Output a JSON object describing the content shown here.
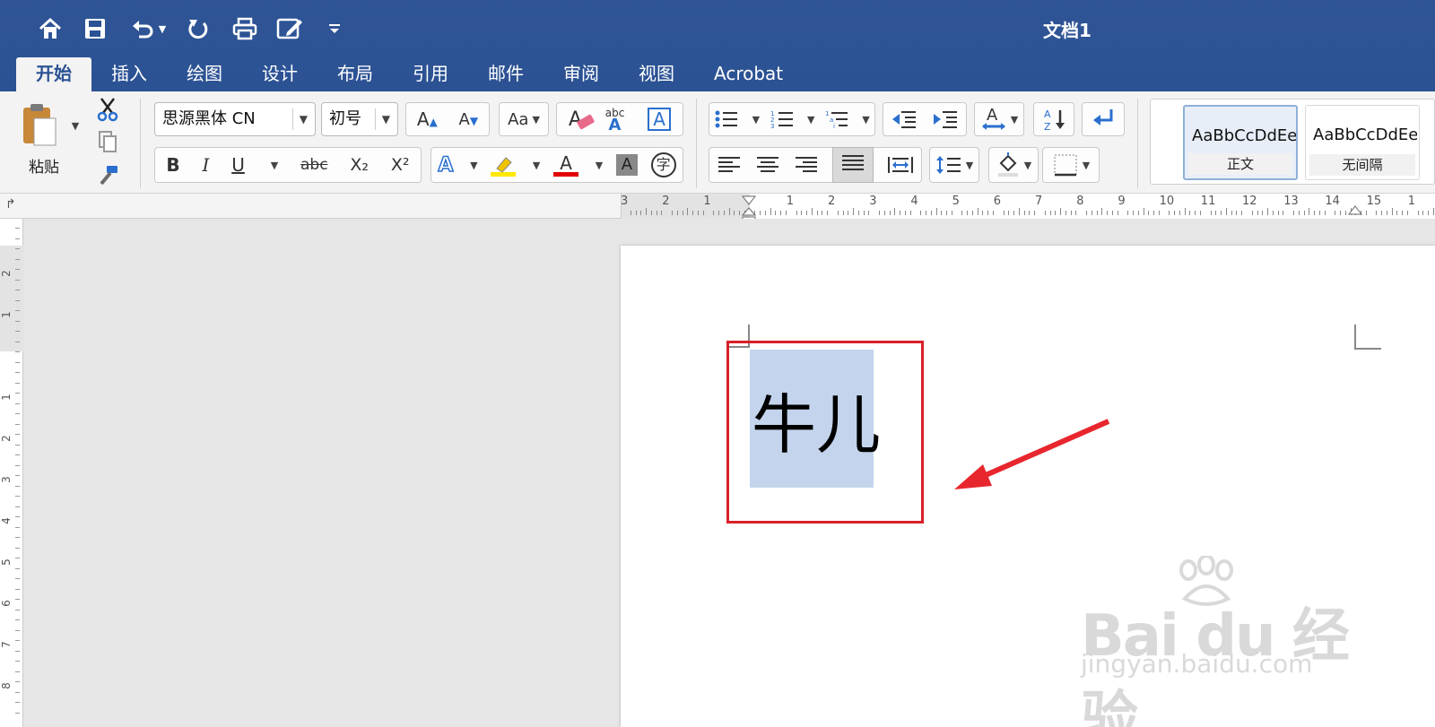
{
  "window": {
    "title": "文档1"
  },
  "tabs": [
    {
      "label": "开始",
      "active": true
    },
    {
      "label": "插入"
    },
    {
      "label": "绘图"
    },
    {
      "label": "设计"
    },
    {
      "label": "布局"
    },
    {
      "label": "引用"
    },
    {
      "label": "邮件"
    },
    {
      "label": "审阅"
    },
    {
      "label": "视图"
    },
    {
      "label": "Acrobat"
    }
  ],
  "clipboard": {
    "paste_label": "粘贴"
  },
  "font": {
    "family": "思源黑体 CN",
    "size": "初号"
  },
  "format_labels": {
    "bold": "B",
    "italic": "I",
    "underline": "U",
    "strikethrough": "abc",
    "subscript": "X₂",
    "superscript": "X²",
    "char_shading": "A",
    "enclose": "字",
    "grow": "A",
    "shrink": "A",
    "change_case": "Aa",
    "clear_format": "A",
    "phonetic_top": "abc",
    "phonetic_bottom": "A",
    "border_char": "A",
    "text_effect": "A",
    "font_color": "A"
  },
  "styles": [
    {
      "sample": "AaBbCcDdEe",
      "name": "正文",
      "selected": true
    },
    {
      "sample": "AaBbCcDdEe",
      "name": "无间隔"
    }
  ],
  "hruler": {
    "labels": [
      "3",
      "2",
      "1",
      "",
      "1",
      "2",
      "3",
      "4",
      "5",
      "6",
      "7",
      "8",
      "9",
      "10",
      "11",
      "12",
      "13",
      "14",
      "15",
      "1"
    ]
  },
  "vruler": {
    "labels": [
      "2",
      "1",
      "1",
      "2",
      "3",
      "4",
      "5",
      "6",
      "7",
      "8"
    ]
  },
  "document": {
    "selected_text": "牛儿"
  },
  "watermark": {
    "main": "Bai du 经验",
    "sub": "jingyan.baidu.com"
  },
  "colors": {
    "title_bg": "#2b5293",
    "highlight": "#ffe800",
    "font_color": "#e00000",
    "selection": "#c4d4ec",
    "annotation": "#d9202a"
  }
}
